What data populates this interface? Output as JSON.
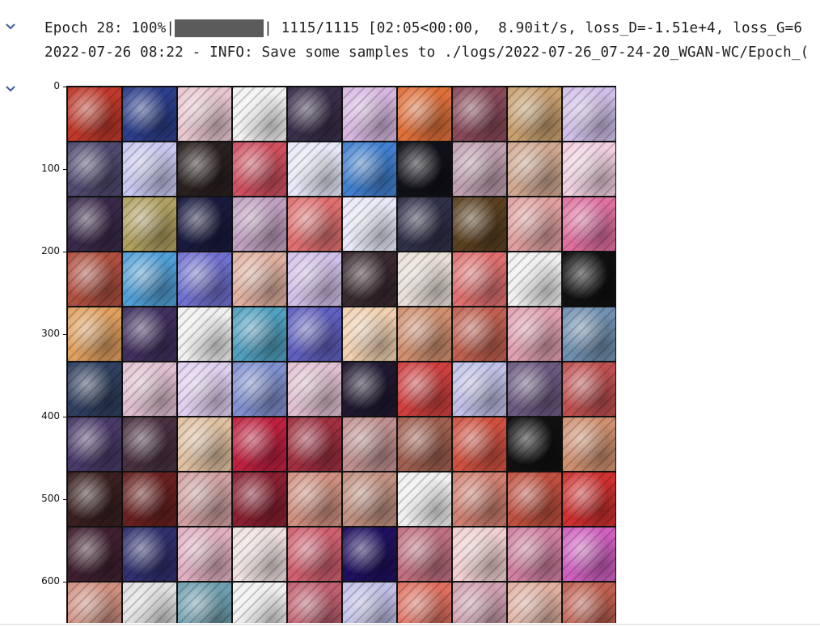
{
  "cell_1": {
    "line_prefix": "Epoch 28: 100%|",
    "line_suffix": "| 1115/1115 [02:05<00:00,  8.90it/s, loss_D=-1.51e+4, loss_G=6",
    "progress": 1.0,
    "line_2": "2022-07-26 08:22 - INFO: Save some samples to ./logs/2022-07-26_07-24-20_WGAN-WC/Epoch_("
  },
  "plot": {
    "y_ticks": [
      "0",
      "100",
      "200",
      "300",
      "400",
      "500",
      "600"
    ],
    "grid_cols": 10,
    "grid_rows_visible": 10,
    "tile_colors": [
      [
        "#c0392b",
        "#2c3e8c",
        "#e8c8d0",
        "#f2f2f2",
        "#3a2f4a",
        "#d7b7e0",
        "#e0703a",
        "#8a4a5a",
        "#c8a070",
        "#d0c0e8"
      ],
      [
        "#504a70",
        "#c8c8f0",
        "#2a2020",
        "#d05060",
        "#e8e8f8",
        "#4080d0",
        "#101018",
        "#c0a0b0",
        "#d0a890",
        "#f0d0e0"
      ],
      [
        "#3a2a4a",
        "#b0a060",
        "#1a1a40",
        "#c0a0c0",
        "#e07070",
        "#e8e8f8",
        "#30304a",
        "#5a4020",
        "#e0a0a0",
        "#e070a0"
      ],
      [
        "#b05040",
        "#50a0d8",
        "#7070d0",
        "#e0b0a0",
        "#d0c0e8",
        "#3a2a30",
        "#e8e0d8",
        "#e07070",
        "#f0f0f0",
        "#101010"
      ],
      [
        "#e0a060",
        "#403060",
        "#f0f0f0",
        "#50a0c0",
        "#6060c0",
        "#f0d0b0",
        "#d09070",
        "#c06050",
        "#e0a0b0",
        "#7090b0"
      ],
      [
        "#304060",
        "#e0c0d0",
        "#e0d0f0",
        "#8090d0",
        "#e0c0d0",
        "#201830",
        "#d04040",
        "#c0c0e8",
        "#6a5a80",
        "#c05050"
      ],
      [
        "#4a3a6a",
        "#4a3040",
        "#e0c0a0",
        "#c02040",
        "#a03040",
        "#c09090",
        "#a06050",
        "#d05040",
        "#101010",
        "#d09070"
      ],
      [
        "#3a2020",
        "#6a2020",
        "#d0a0a0",
        "#8a2030",
        "#d09080",
        "#c09080",
        "#f0f0f0",
        "#d08070",
        "#c05040",
        "#d03030"
      ],
      [
        "#402030",
        "#303070",
        "#e0b0c0",
        "#f0e0e0",
        "#d06070",
        "#201060",
        "#c07080",
        "#f0d0d0",
        "#d080a0",
        "#d060c0"
      ],
      [
        "#d09080",
        "#e0e0e0",
        "#70a0b0",
        "#f0f0f0",
        "#c06070",
        "#c0c0e8",
        "#e07060",
        "#d0a0b0",
        "#e0b0a0",
        "#c06050"
      ]
    ]
  }
}
